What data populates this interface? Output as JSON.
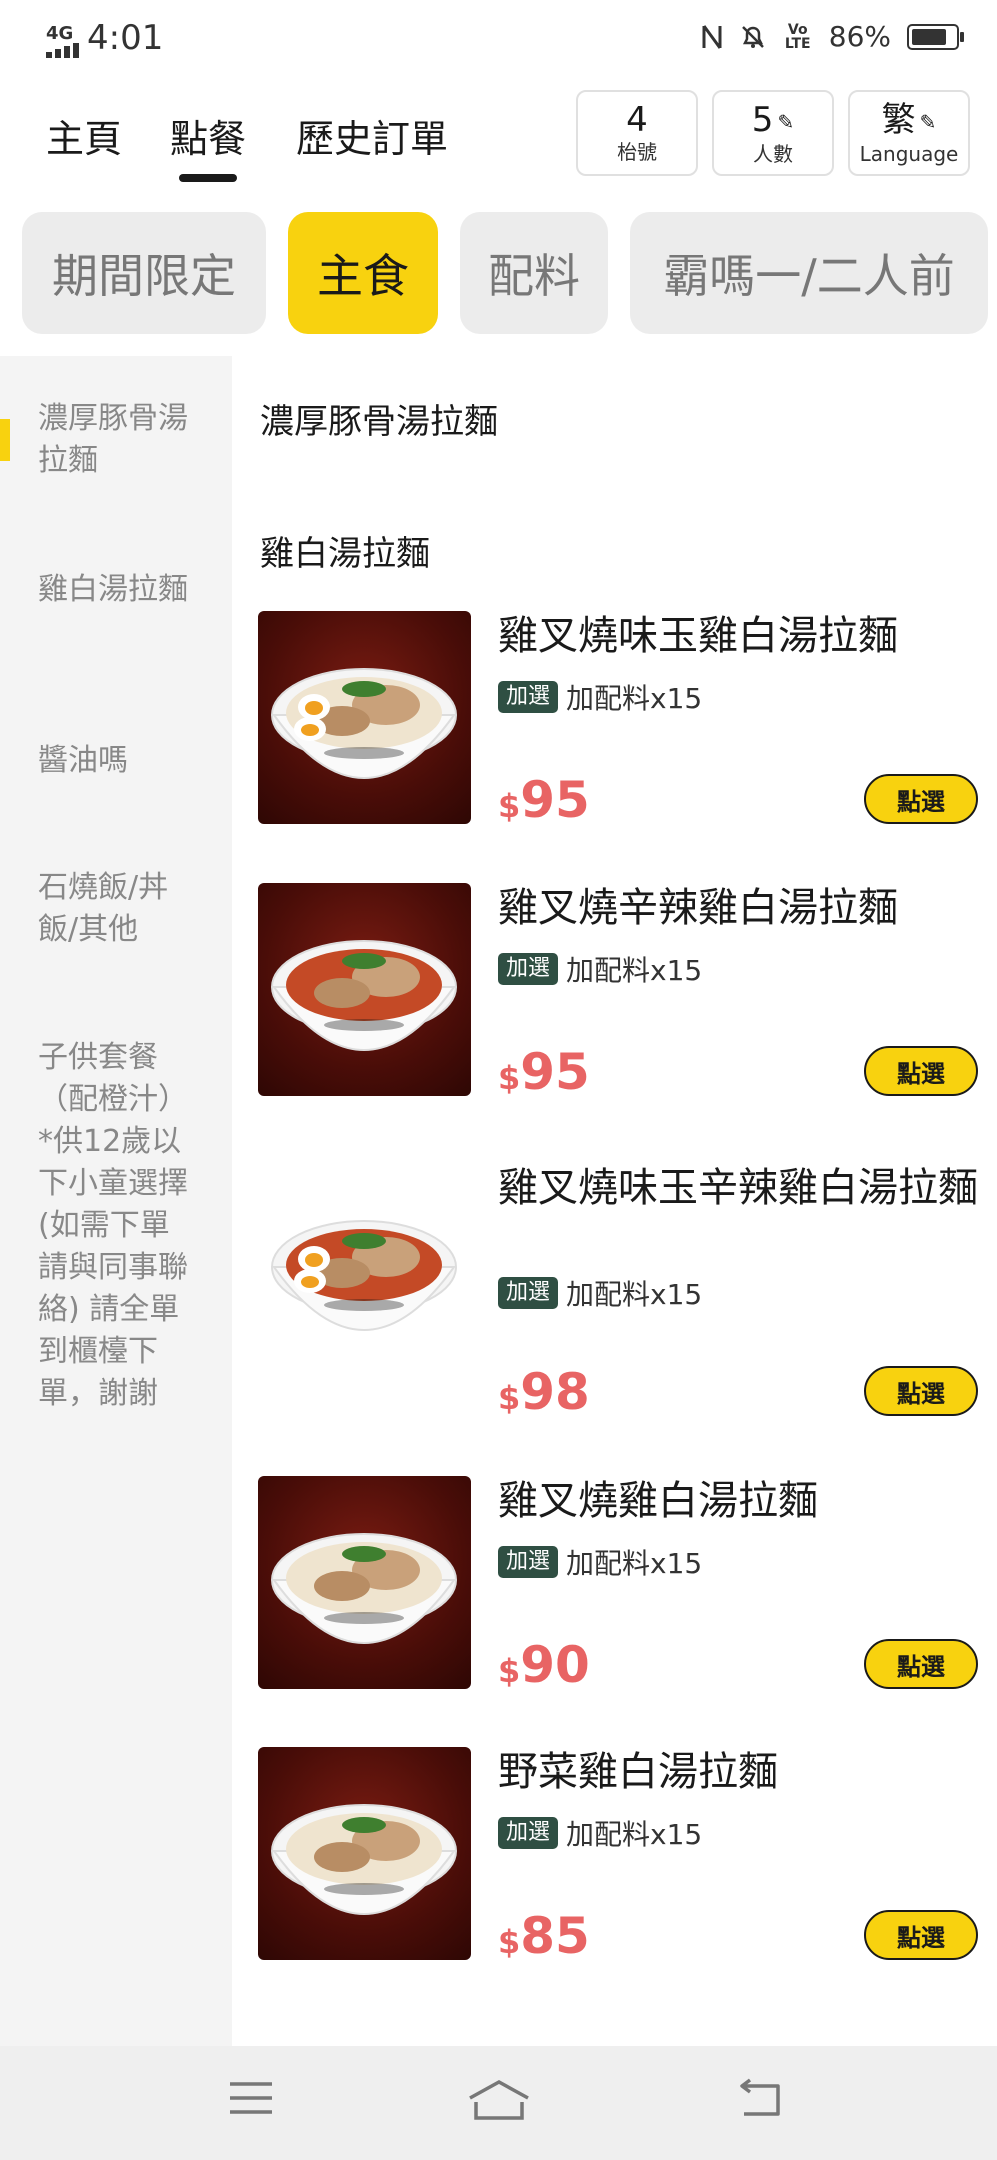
{
  "status_bar": {
    "network": "4G",
    "time": "4:01",
    "lte": "Vo LTE",
    "battery_text": "86%",
    "battery_level": 0.86
  },
  "nav": {
    "tabs": [
      "主頁",
      "點餐",
      "歷史訂單"
    ],
    "active_tab": "點餐",
    "table": {
      "value": "4",
      "label": "枱號"
    },
    "people": {
      "value": "5",
      "label": "人數"
    },
    "language": {
      "value": "繁",
      "label": "Language"
    }
  },
  "categories": [
    "期間限定",
    "主食",
    "配料",
    "霸嗎一/二人前"
  ],
  "active_category": "主食",
  "side_menu": [
    "濃厚豚骨湯拉麵",
    "雞白湯拉麵",
    "醬油嗎",
    "石燒飯/丼飯/其他",
    "子供套餐（配橙汁）*供12歲以下小童選擇 (如需下單請與同事聯絡) 請全單到櫃檯下單，謝謝"
  ],
  "sections": [
    "濃厚豚骨湯拉麵",
    "雞白湯拉麵"
  ],
  "items": [
    {
      "name": "雞叉燒味玉雞白湯拉麵",
      "tag": "加選",
      "addon": "加配料x15",
      "currency": "$",
      "price": "95",
      "button": "點選",
      "broth": "white",
      "egg": true
    },
    {
      "name": "雞叉燒辛辣雞白湯拉麵",
      "tag": "加選",
      "addon": "加配料x15",
      "currency": "$",
      "price": "95",
      "button": "點選",
      "broth": "red",
      "egg": false
    },
    {
      "name": "雞叉燒味玉辛辣雞白湯拉麵",
      "tag": "加選",
      "addon": "加配料x15",
      "currency": "$",
      "price": "98",
      "button": "點選",
      "broth": "red",
      "egg": true
    },
    {
      "name": "雞叉燒雞白湯拉麵",
      "tag": "加選",
      "addon": "加配料x15",
      "currency": "$",
      "price": "90",
      "button": "點選",
      "broth": "white",
      "egg": false
    },
    {
      "name": "野菜雞白湯拉麵",
      "tag": "加選",
      "addon": "加配料x15",
      "currency": "$",
      "price": "85",
      "button": "點選",
      "broth": "white",
      "egg": false
    }
  ],
  "colors": {
    "accent": "#f8d20f",
    "price": "#e86464",
    "tag": "#2f4f43"
  }
}
